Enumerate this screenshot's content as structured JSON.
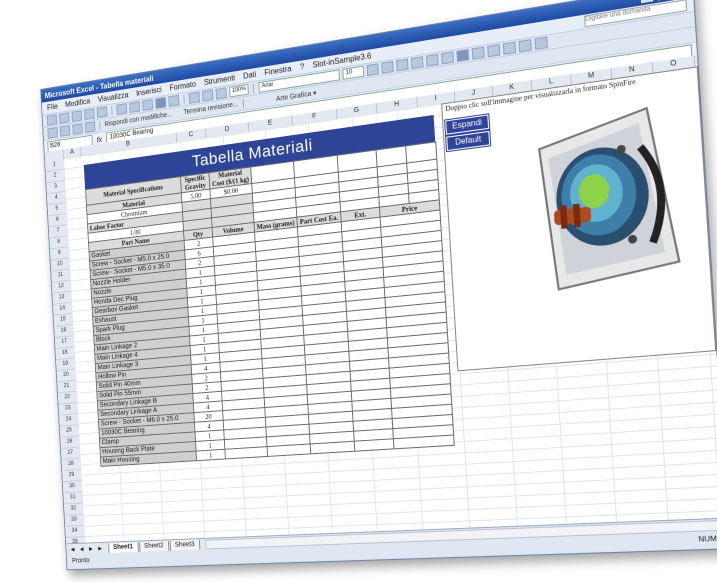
{
  "window": {
    "title": "Microsoft Excel - Tabella materiali"
  },
  "menu": {
    "items": [
      "File",
      "Modifica",
      "Visualizza",
      "Inserisci",
      "Formato",
      "Strumenti",
      "Dati",
      "Finestra",
      "?",
      "Slot-inSample3.6"
    ],
    "help_placeholder": "Digitare una domanda"
  },
  "toolbar": {
    "font": "Arial",
    "size": "10",
    "review_label": "Rispondi con modifiche...",
    "track_label": "Termina revisione...",
    "active_label": "Arte Grafica ▾"
  },
  "formula": {
    "cell": "B28",
    "fx": "fx",
    "value": "10030C Bearing"
  },
  "columns": [
    "A",
    "B",
    "C",
    "D",
    "E",
    "F",
    "G",
    "H",
    "I",
    "J",
    "K",
    "L",
    "M",
    "N",
    "O"
  ],
  "rows": [
    "1",
    "2",
    "3",
    "4",
    "5",
    "6",
    "7",
    "8",
    "9",
    "10",
    "11",
    "12",
    "13",
    "14",
    "15",
    "16",
    "17",
    "18",
    "19",
    "20",
    "21",
    "22",
    "23",
    "24",
    "25",
    "26",
    "27",
    "28",
    "29",
    "30",
    "31",
    "32",
    "33",
    "34",
    "35",
    "36"
  ],
  "table": {
    "title": "Tabella Materiali",
    "spec_header": "Material Specifications",
    "gravity_header": "Specific Gravity",
    "cost_header": "Material Cost ($/(1 kg)",
    "material_label": "Material",
    "material_value": "Chromium",
    "gravity_value": "5.00",
    "cost_value": "$0.00",
    "labor_label": "Labor Factor",
    "labor_value": "1.00",
    "col_part": "Part Name",
    "col_qty": "Qty",
    "col_volume": "Volume",
    "col_mass": "Mass (grams)",
    "col_cost_ea": "Part Cost Ea.",
    "col_ext": "Ext.",
    "col_price": "Price"
  },
  "parts": [
    {
      "name": "Gasket",
      "qty": "2"
    },
    {
      "name": "Screw - Socket - M5.0 x 25.0",
      "qty": "6"
    },
    {
      "name": "Screw - Socket - M5.0 x 35.0",
      "qty": "2"
    },
    {
      "name": "Nozzle Holder",
      "qty": "1"
    },
    {
      "name": "Nozzle",
      "qty": "1"
    },
    {
      "name": "Honda Dec Plug",
      "qty": "1"
    },
    {
      "name": "Gearbox Gasket",
      "qty": "1"
    },
    {
      "name": "Exhaust",
      "qty": "1"
    },
    {
      "name": "Spark Plug",
      "qty": "1"
    },
    {
      "name": "Block",
      "qty": "1"
    },
    {
      "name": "Main Linkage 2",
      "qty": "1"
    },
    {
      "name": "Main Linkage 4",
      "qty": "1"
    },
    {
      "name": "Main Linkage 3",
      "qty": "1"
    },
    {
      "name": "Hollow Pin",
      "qty": "4"
    },
    {
      "name": "Solid Pin 40mm",
      "qty": "2"
    },
    {
      "name": "Solid Pin 55mm",
      "qty": "2"
    },
    {
      "name": "Secondary Linkage B",
      "qty": "4"
    },
    {
      "name": "Secondary Linkage A",
      "qty": "4"
    },
    {
      "name": "Screw - Socket - M6.0 x 25.0",
      "qty": "20"
    },
    {
      "name": "10030C Bearing",
      "qty": "4"
    },
    {
      "name": "Clamp",
      "qty": "1"
    },
    {
      "name": "Housing Back Plate",
      "qty": "1"
    },
    {
      "name": "Main Housing",
      "qty": "1"
    }
  ],
  "side_panel": {
    "note": "Doppio clic sull'immagine per visualizzarla in formato SpinFire",
    "btn_expand": "Espandi",
    "btn_default": "Default"
  },
  "tabs": [
    "Sheet1",
    "Sheet2",
    "Sheet3"
  ],
  "status": {
    "left": "Pronto",
    "right": "NUM"
  },
  "colors": {
    "title_bg": "#2e4496",
    "titlebar": "#1e4aa2"
  }
}
